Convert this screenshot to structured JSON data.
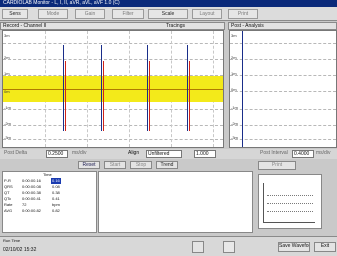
{
  "window": {
    "title": "CARDIOLAB Monitor - L, I, II, aVR, aVL, aVF 1.0 (C)"
  },
  "toolbar": {
    "buttons": [
      "Sens",
      "Mode",
      "Gain",
      "Filter",
      "Scale",
      "Layout",
      "Print"
    ]
  },
  "left_panel": {
    "title": "Record - Channel II",
    "header_right": "Tracings",
    "y_ticks": [
      "3m",
      "2m",
      "1m",
      "0m",
      "-1m",
      "-2m",
      "-3m"
    ],
    "footer_label": "Post Delta",
    "footer_value": "0.2500",
    "footer_unit": "ms/div"
  },
  "right_panel": {
    "title": "Post - Analysis",
    "y_ticks": [
      "3m",
      "2m",
      "1m",
      "0m",
      "-1m",
      "-2m",
      "-3m"
    ],
    "footer_label": "Post Interval",
    "footer_value": "0.4000",
    "footer_unit": "ms/div"
  },
  "controls": {
    "align_label": "Align",
    "mode_value": "Unfiltered",
    "max_value": "1.000",
    "tabs": [
      "Reset",
      "Start",
      "Stop",
      "Trend"
    ],
    "print_label": "Print"
  },
  "measurements": {
    "col_header": "Time",
    "rows": [
      {
        "name": "P-R",
        "time": "0:00:00.16",
        "val": "0.16"
      },
      {
        "name": "QRS",
        "time": "0:00:00.08",
        "val": "0.08"
      },
      {
        "name": "QT",
        "time": "0:00:00.38",
        "val": "0.38"
      },
      {
        "name": "QTc",
        "time": "0:00:00.41",
        "val": "0.41"
      },
      {
        "name": "Rate",
        "time": "72",
        "val": "bpm"
      },
      {
        "name": "AVG",
        "time": "0:00:00.82",
        "val": "0.82"
      }
    ]
  },
  "status": {
    "date_label": "Run Time",
    "date_value": "02/10/02 15:32",
    "right_btn_1": "Save Waveform",
    "right_btn_2": "Exit"
  }
}
